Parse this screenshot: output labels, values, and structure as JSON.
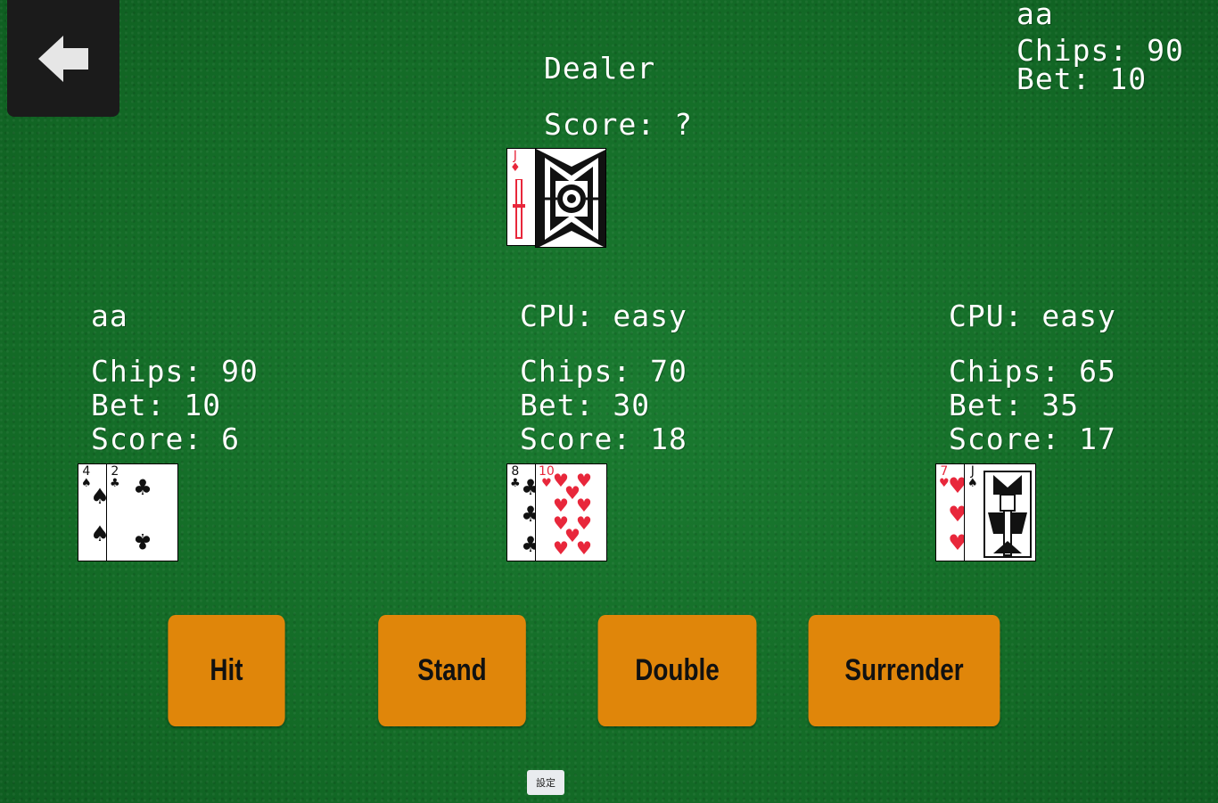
{
  "top_right_player": {
    "name": "aa",
    "chips": "Chips: 90",
    "bet": "Bet: 10"
  },
  "dealer": {
    "title": "Dealer",
    "score": "Score: ?",
    "card1": {
      "rank": "J",
      "suit": "♦"
    }
  },
  "players": [
    {
      "name": "aa",
      "chips": "Chips: 90",
      "bet": "Bet: 10",
      "score": "Score: 6",
      "cards": [
        {
          "rank": "4",
          "suit": "♠"
        },
        {
          "rank": "2",
          "suit": "♣"
        }
      ]
    },
    {
      "name": "CPU: easy",
      "chips": "Chips: 70",
      "bet": "Bet: 30",
      "score": "Score: 18",
      "cards": [
        {
          "rank": "8",
          "suit": "♣"
        },
        {
          "rank": "10",
          "suit": "♥"
        }
      ]
    },
    {
      "name": "CPU: easy",
      "chips": "Chips: 65",
      "bet": "Bet: 35",
      "score": "Score: 17",
      "cards": [
        {
          "rank": "7",
          "suit": "♥"
        },
        {
          "rank": "J",
          "suit": "♠"
        }
      ]
    }
  ],
  "actions": {
    "hit": "Hit",
    "stand": "Stand",
    "double": "Double",
    "surrender": "Surrender"
  },
  "settings_label": "設定",
  "icons": {
    "back": "back-arrow-icon"
  },
  "colors": {
    "felt": "#14702a",
    "button": "#e0860a",
    "red_suit": "#e8273b"
  }
}
